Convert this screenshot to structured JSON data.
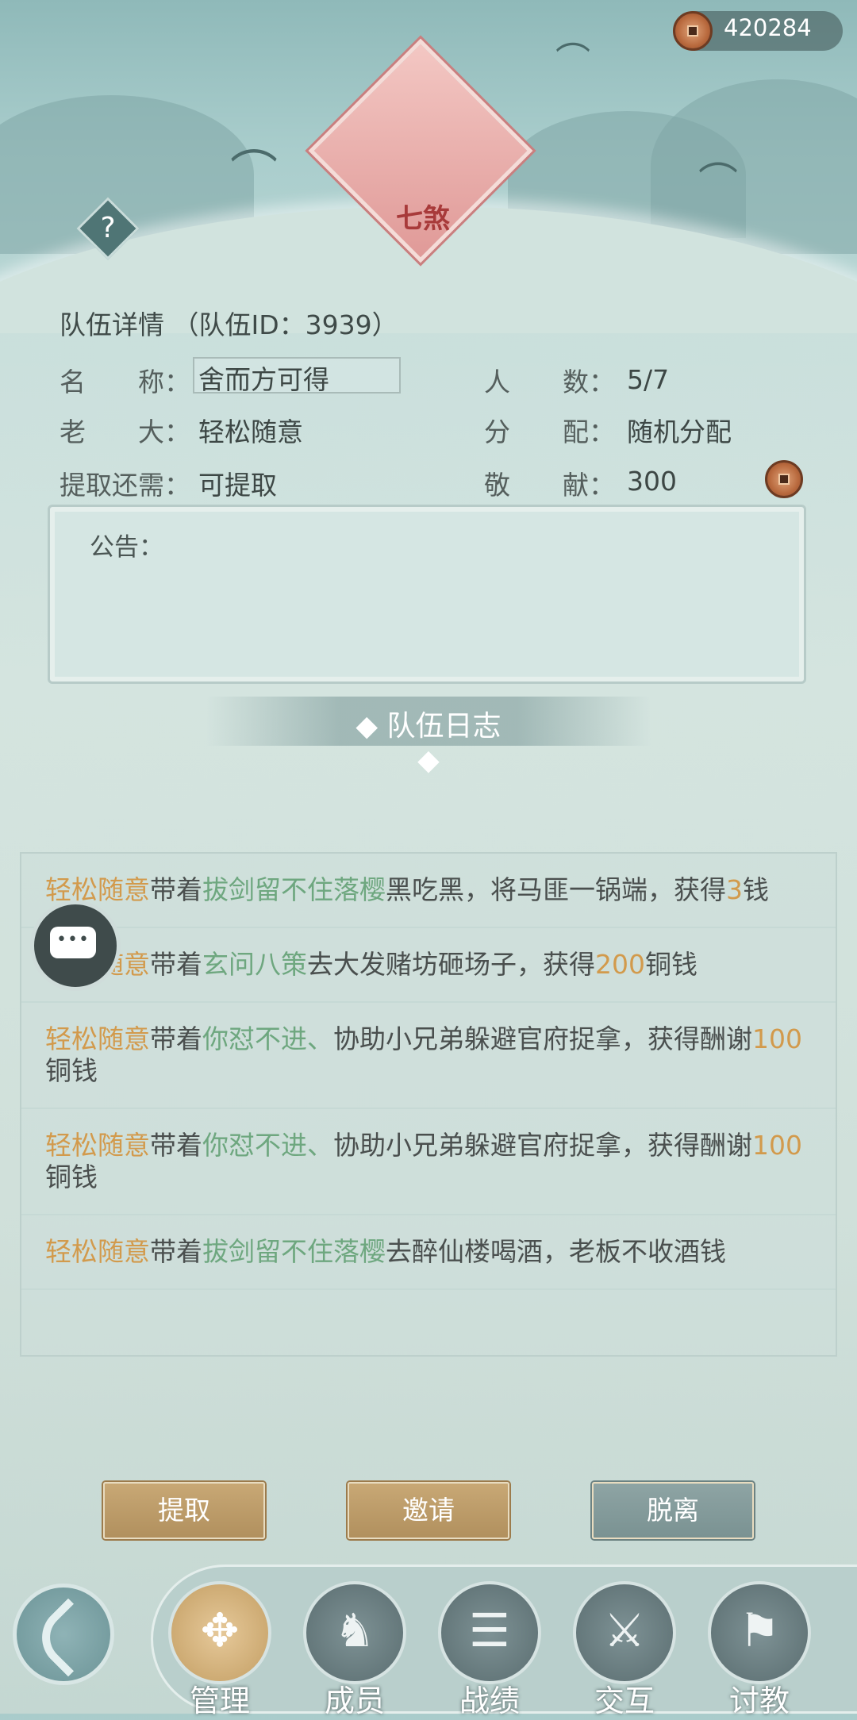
{
  "currency": {
    "value": "420284",
    "icon": "copper-coin-icon"
  },
  "emblem": {
    "title": "七煞"
  },
  "team": {
    "section_title": "队伍详情 （队伍ID：3939）",
    "name_label": "名　　称：",
    "name_value": "舍而方可得",
    "members_label": "人　　数：",
    "members_value": "5/7",
    "leader_label": "老　　大：",
    "leader_value": "轻松随意",
    "distribution_label": "分　　配：",
    "distribution_value": "随机分配",
    "withdraw_label": "提取还需：",
    "withdraw_value": "可提取",
    "contribution_label": "敬　　献：",
    "contribution_value": "300"
  },
  "notice": {
    "label": "公告："
  },
  "log": {
    "title": "◆ 队伍日志 ◆",
    "items": [
      {
        "actor": "轻松随意",
        "t1": "带着",
        "partner": "拔剑留不住落樱",
        "t2": "黑吃黑，将马匪一锅端，获得",
        "amount": "3",
        "t3": "钱"
      },
      {
        "actor": "轻松随意",
        "t1": "带着",
        "partner": "玄问八策",
        "t2": "去大发赌坊砸场子，获得",
        "amount": "200",
        "t3": "铜钱"
      },
      {
        "actor": "轻松随意",
        "t1": "带着",
        "partner": "你怼不进、",
        "t2": "协助小兄弟躲避官府捉拿，获得酬谢",
        "amount": "100",
        "t3": "铜钱"
      },
      {
        "actor": "轻松随意",
        "t1": "带着",
        "partner": "你怼不进、",
        "t2": "协助小兄弟躲避官府捉拿，获得酬谢",
        "amount": "100",
        "t3": "铜钱"
      },
      {
        "actor": "轻松随意",
        "t1": "带着",
        "partner": "拔剑留不住落樱",
        "t2": "去醉仙楼喝酒，老板不收酒钱",
        "amount": "",
        "t3": ""
      }
    ]
  },
  "buttons": {
    "withdraw": "提取",
    "invite": "邀请",
    "leave": "脱离"
  },
  "nav": {
    "items": [
      {
        "label": "管理",
        "icon": "manage-icon",
        "active": true
      },
      {
        "label": "成员",
        "icon": "members-icon",
        "active": false
      },
      {
        "label": "战绩",
        "icon": "record-icon",
        "active": false
      },
      {
        "label": "交互",
        "icon": "interact-icon",
        "active": false
      },
      {
        "label": "讨教",
        "icon": "challenge-icon",
        "active": false
      }
    ]
  },
  "colors": {
    "accent_orange": "#d29a4c",
    "accent_green": "#6ea77f",
    "button_gold": "#b1905e",
    "button_gray": "#7a9292"
  }
}
